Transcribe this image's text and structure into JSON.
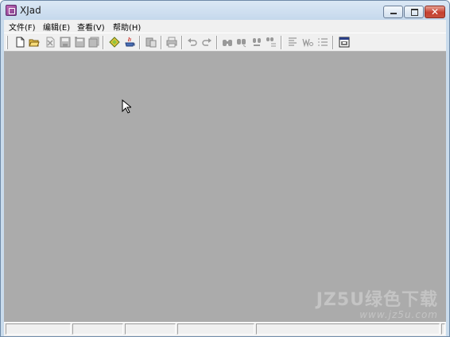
{
  "window": {
    "title": "XJad",
    "controls": [
      "minimize-icon",
      "maximize-icon",
      "close-icon"
    ]
  },
  "menubar": {
    "items": [
      {
        "label": "文件(F)"
      },
      {
        "label": "编辑(E)"
      },
      {
        "label": "查看(V)"
      },
      {
        "label": "帮助(H)"
      }
    ]
  },
  "toolbar": {
    "buttons": [
      {
        "icon": "new-file-icon",
        "enabled": true
      },
      {
        "icon": "open-folder-icon",
        "enabled": true
      },
      {
        "icon": "delete-icon",
        "enabled": false
      },
      {
        "icon": "save-icon",
        "enabled": false
      },
      {
        "icon": "save-as-icon",
        "enabled": false
      },
      {
        "icon": "save-all-icon",
        "enabled": false
      },
      {
        "icon": "decompile-icon",
        "enabled": true
      },
      {
        "icon": "java-icon",
        "enabled": true
      },
      {
        "icon": "paste-icon",
        "enabled": false
      },
      {
        "icon": "print-icon",
        "enabled": false
      },
      {
        "icon": "undo-icon",
        "enabled": false
      },
      {
        "icon": "redo-icon",
        "enabled": false
      },
      {
        "icon": "find-icon",
        "enabled": false
      },
      {
        "icon": "find-next-icon",
        "enabled": false
      },
      {
        "icon": "replace-icon",
        "enabled": false
      },
      {
        "icon": "replace-all-icon",
        "enabled": false
      },
      {
        "icon": "align-left-icon",
        "enabled": false
      },
      {
        "icon": "word-wrap-icon",
        "enabled": false
      },
      {
        "icon": "line-numbers-icon",
        "enabled": false
      },
      {
        "icon": "options-icon",
        "enabled": true
      }
    ]
  },
  "watermark": {
    "line1": "JZ5U绿色下载",
    "line2": "www.jz5u.com"
  },
  "statusbar": {
    "panes": [
      "",
      "",
      "",
      "",
      "",
      ""
    ]
  },
  "colors": {
    "client_background": "#ababab",
    "frame": "#c9dbec",
    "close_button": "#c53f2f"
  }
}
